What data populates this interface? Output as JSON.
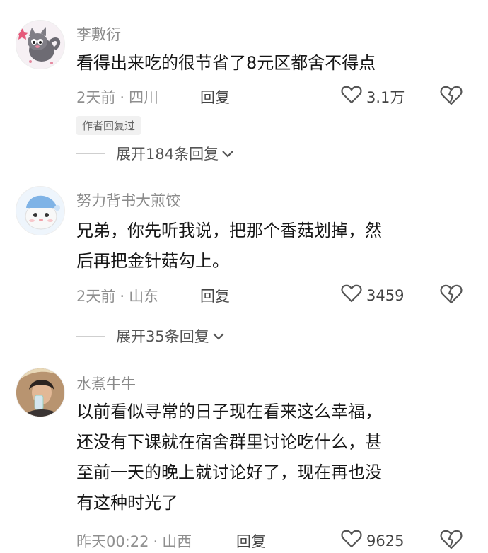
{
  "comments": [
    {
      "username": "李敷衍",
      "lines": [
        "看得出来吃的很节省了8元区都舍不得点"
      ],
      "time": "2天前",
      "location": "四川",
      "reply_label": "回复",
      "likes": "3.1万",
      "author_badge": "作者回复过",
      "expand_label": "展开184条回复"
    },
    {
      "username": "努力背书大煎饺",
      "lines": [
        "兄弟，你先听我说，把那个香菇划掉，然",
        "后再把金针菇勾上。"
      ],
      "time": "2天前",
      "location": "山东",
      "reply_label": "回复",
      "likes": "3459",
      "expand_label": "展开35条回复"
    },
    {
      "username": "水煮牛牛",
      "lines": [
        "以前看似寻常的日子现在看来这么幸福，",
        "还没有下课就在宿舍群里讨论吃什么，甚",
        "至前一天的晚上就讨论好了，现在再也没",
        "有这种时光了"
      ],
      "time": "昨天00:22",
      "location": "山西",
      "reply_label": "回复",
      "likes": "9625"
    }
  ],
  "separator": "·",
  "icons": {
    "like": "heart-outline-icon",
    "dislike": "broken-heart-icon",
    "expand": "chevron-down-icon"
  },
  "colors": {
    "text": "#161616",
    "meta": "#8f8f8f",
    "username": "#8a8a8a"
  }
}
